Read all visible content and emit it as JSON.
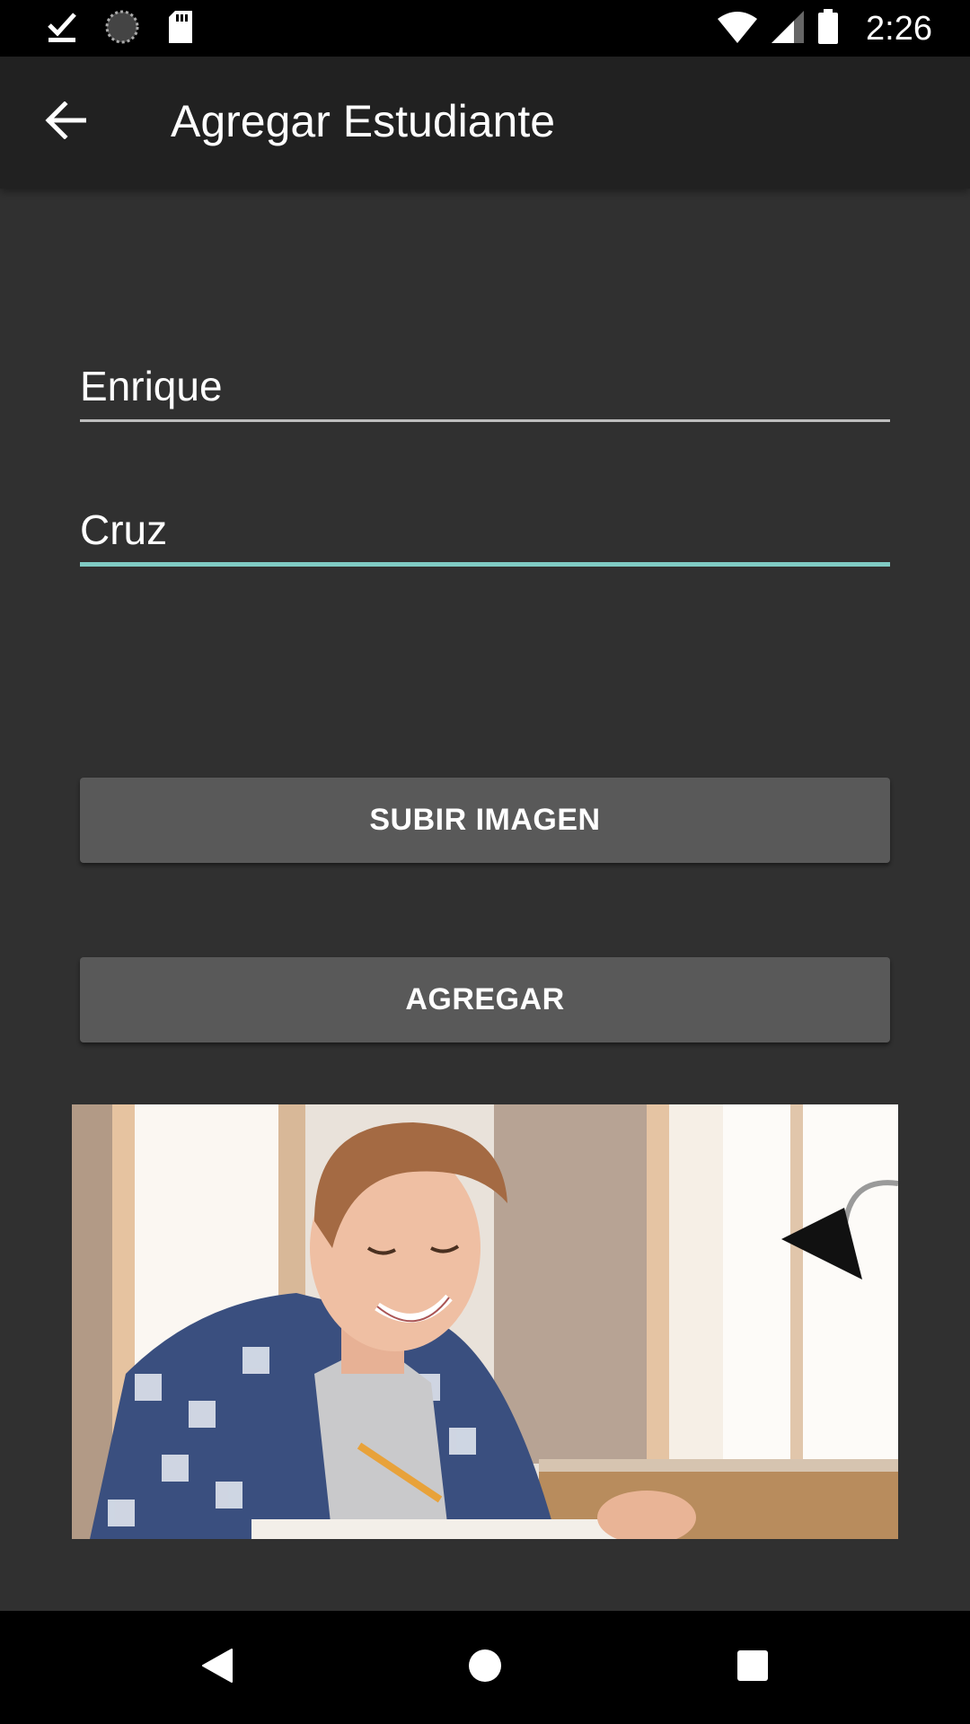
{
  "status_bar": {
    "time": "2:26",
    "icons": [
      "download-done-icon",
      "sync-icon",
      "sd-card-icon",
      "wifi-icon",
      "signal-icon",
      "battery-icon"
    ]
  },
  "app_bar": {
    "title": "Agregar Estudiante",
    "back_icon": "arrow-back-icon"
  },
  "form": {
    "first_name": "Enrique",
    "last_name": "Cruz"
  },
  "buttons": {
    "upload_label": "SUBIR IMAGEN",
    "add_label": "AGREGAR"
  },
  "image": {
    "description_icon": "student-photo"
  },
  "nav_bar": {
    "icons": [
      "back-triangle-icon",
      "home-circle-icon",
      "recents-square-icon"
    ]
  },
  "colors": {
    "background": "#303030",
    "app_bar": "#212121",
    "button": "#595959",
    "accent": "#80cbc4"
  }
}
